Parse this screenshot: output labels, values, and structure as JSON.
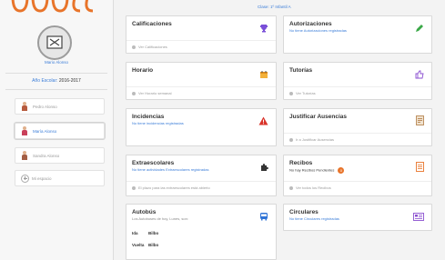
{
  "brand": {
    "logo_text": "OUUCC",
    "logo_color": "#e8742a"
  },
  "sidebar": {
    "profile_name": "Mario Alonso",
    "school_year_label": "Año Escolar:",
    "school_year_value": "2016-2017",
    "children": [
      {
        "name": "Pedro Alonso",
        "active": false
      },
      {
        "name": "María Alonso",
        "active": true
      },
      {
        "name": "Sandra Alonso",
        "active": false
      }
    ],
    "add_label": "Mi espacio"
  },
  "header": {
    "class_info": "Clase: 1º Infantil A"
  },
  "cards": {
    "calificaciones": {
      "title": "Calificaciones",
      "footer": "Ver Calificaciones"
    },
    "autorizaciones": {
      "title": "Autorizaciones",
      "subtitle": "No tiene Autorizaciones registradas"
    },
    "horario": {
      "title": "Horario",
      "footer": "Ver Horario semanal"
    },
    "tutorias": {
      "title": "Tutorías",
      "footer": "Ver Tutorías"
    },
    "incidencias": {
      "title": "Incidencias",
      "subtitle": "No tiene incidencias registradas"
    },
    "justificar": {
      "title": "Justificar Ausencias",
      "footer": "Ir a Justificar Ausencias"
    },
    "extraescolares": {
      "title": "Extraescolares",
      "subtitle": "No tiene actividades Extraescolares registradas",
      "footer": "El plazo para las extraescolares está abierto"
    },
    "recibos": {
      "title": "Recibos",
      "subtitle": "No hay Recibos Pendientes",
      "badge": "0",
      "footer": "Ver todos los Recibos"
    },
    "autobus": {
      "title": "Autobús",
      "subtitle": "Los Autobuses de hoy, Lunes, son:",
      "rows": [
        {
          "label": "Ida",
          "value": "Bilbo"
        },
        {
          "label": "Vuelta",
          "value": "Bilbo"
        }
      ]
    },
    "circulares": {
      "title": "Circulares",
      "subtitle": "No tiene Circulares registradas"
    }
  },
  "colors": {
    "accent_blue": "#3b7dd8",
    "brand_orange": "#e8742a"
  }
}
